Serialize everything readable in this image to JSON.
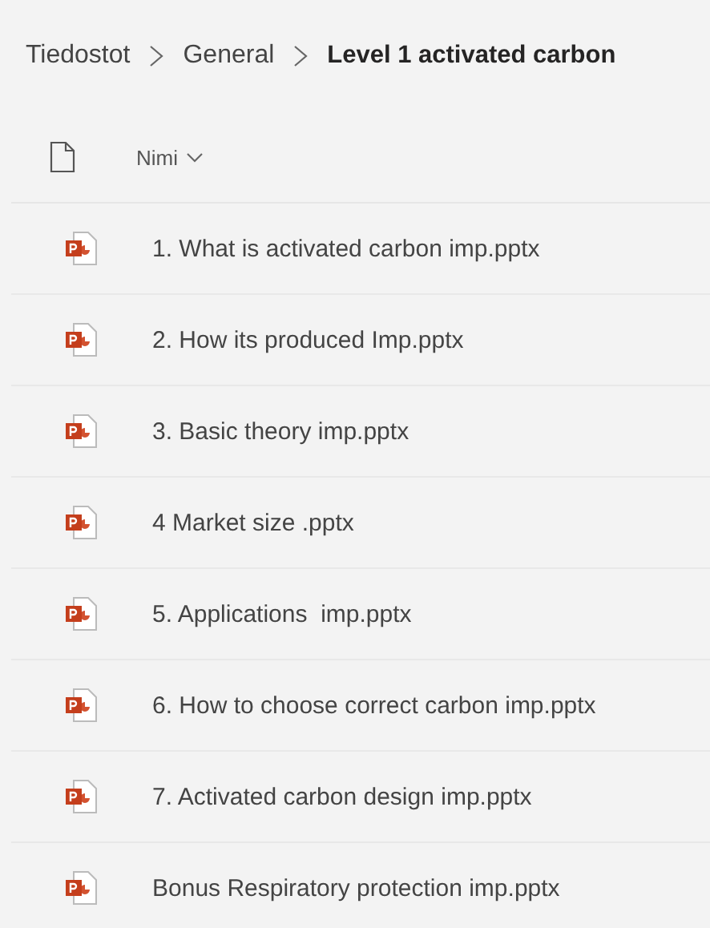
{
  "breadcrumb": [
    "Tiedostot",
    "General",
    "Level 1 activated carbon"
  ],
  "table": {
    "columns": [
      {
        "label": "Nimi",
        "sorted": true
      }
    ],
    "rows": [
      {
        "name": "1. What is activated carbon imp.pptx",
        "kind": "powerpoint"
      },
      {
        "name": "2. How its produced Imp.pptx",
        "kind": "powerpoint"
      },
      {
        "name": "3. Basic theory imp.pptx",
        "kind": "powerpoint"
      },
      {
        "name": "4 Market size .pptx",
        "kind": "powerpoint"
      },
      {
        "name": "5. Applications  imp.pptx",
        "kind": "powerpoint"
      },
      {
        "name": "6. How to choose correct carbon imp.pptx",
        "kind": "powerpoint"
      },
      {
        "name": "7. Activated carbon design imp.pptx",
        "kind": "powerpoint"
      },
      {
        "name": "Bonus Respiratory protection imp.pptx",
        "kind": "powerpoint"
      }
    ]
  }
}
